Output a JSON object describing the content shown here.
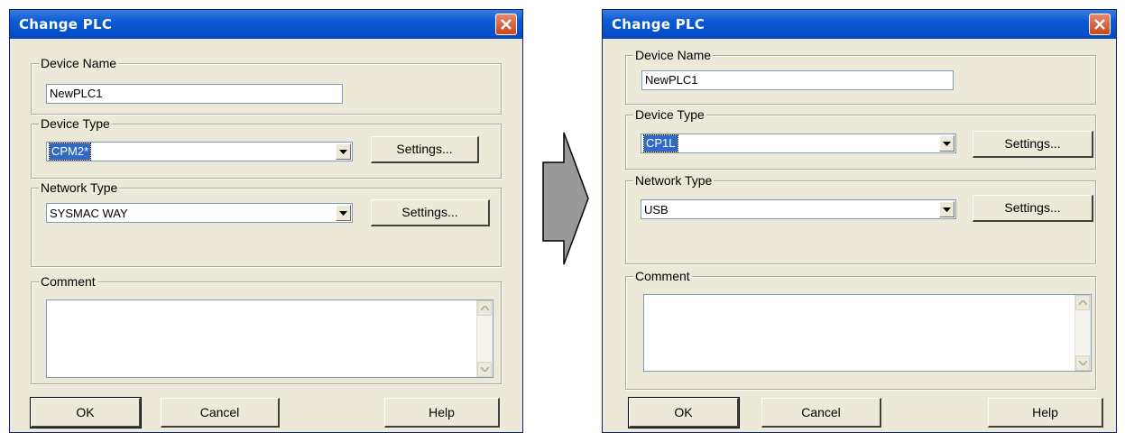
{
  "dialog_before": {
    "title": "Change PLC",
    "device_name": {
      "legend": "Device Name",
      "value": "NewPLC1"
    },
    "device_type": {
      "legend": "Device Type",
      "value": "CPM2*",
      "settings_label": "Settings..."
    },
    "network_type": {
      "legend": "Network Type",
      "value": "SYSMAC WAY",
      "settings_label": "Settings..."
    },
    "comment": {
      "legend": "Comment",
      "value": ""
    },
    "buttons": {
      "ok": "OK",
      "cancel": "Cancel",
      "help": "Help"
    }
  },
  "dialog_after": {
    "title": "Change PLC",
    "device_name": {
      "legend": "Device Name",
      "value": "NewPLC1"
    },
    "device_type": {
      "legend": "Device Type",
      "value": "CP1L",
      "settings_label": "Settings..."
    },
    "network_type": {
      "legend": "Network Type",
      "value": "USB",
      "settings_label": "Settings..."
    },
    "comment": {
      "legend": "Comment",
      "value": ""
    },
    "buttons": {
      "ok": "OK",
      "cancel": "Cancel",
      "help": "Help"
    }
  },
  "colors": {
    "titlebar": "#0a5ad6",
    "dialog_bg": "#ece9d8",
    "selection": "#316ac5",
    "close_button": "#d8603a",
    "arrow": "#999999"
  }
}
